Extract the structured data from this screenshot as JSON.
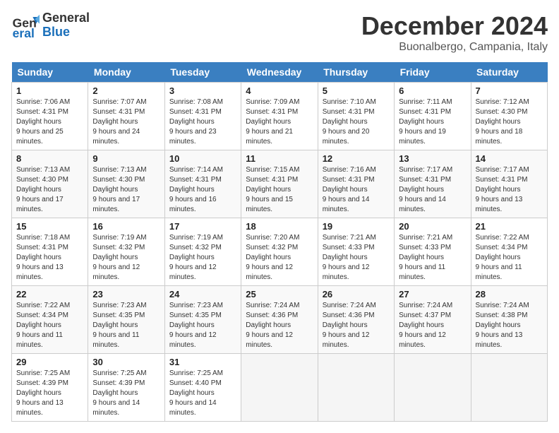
{
  "header": {
    "logo_line1": "General",
    "logo_line2": "Blue",
    "month_title": "December 2024",
    "location": "Buonalbergo, Campania, Italy"
  },
  "days": [
    "Sunday",
    "Monday",
    "Tuesday",
    "Wednesday",
    "Thursday",
    "Friday",
    "Saturday"
  ],
  "weeks": [
    [
      {
        "num": "1",
        "sunrise": "7:06 AM",
        "sunset": "4:31 PM",
        "daylight": "9 hours and 25 minutes."
      },
      {
        "num": "2",
        "sunrise": "7:07 AM",
        "sunset": "4:31 PM",
        "daylight": "9 hours and 24 minutes."
      },
      {
        "num": "3",
        "sunrise": "7:08 AM",
        "sunset": "4:31 PM",
        "daylight": "9 hours and 23 minutes."
      },
      {
        "num": "4",
        "sunrise": "7:09 AM",
        "sunset": "4:31 PM",
        "daylight": "9 hours and 21 minutes."
      },
      {
        "num": "5",
        "sunrise": "7:10 AM",
        "sunset": "4:31 PM",
        "daylight": "9 hours and 20 minutes."
      },
      {
        "num": "6",
        "sunrise": "7:11 AM",
        "sunset": "4:31 PM",
        "daylight": "9 hours and 19 minutes."
      },
      {
        "num": "7",
        "sunrise": "7:12 AM",
        "sunset": "4:30 PM",
        "daylight": "9 hours and 18 minutes."
      }
    ],
    [
      {
        "num": "8",
        "sunrise": "7:13 AM",
        "sunset": "4:30 PM",
        "daylight": "9 hours and 17 minutes."
      },
      {
        "num": "9",
        "sunrise": "7:13 AM",
        "sunset": "4:30 PM",
        "daylight": "9 hours and 17 minutes."
      },
      {
        "num": "10",
        "sunrise": "7:14 AM",
        "sunset": "4:31 PM",
        "daylight": "9 hours and 16 minutes."
      },
      {
        "num": "11",
        "sunrise": "7:15 AM",
        "sunset": "4:31 PM",
        "daylight": "9 hours and 15 minutes."
      },
      {
        "num": "12",
        "sunrise": "7:16 AM",
        "sunset": "4:31 PM",
        "daylight": "9 hours and 14 minutes."
      },
      {
        "num": "13",
        "sunrise": "7:17 AM",
        "sunset": "4:31 PM",
        "daylight": "9 hours and 14 minutes."
      },
      {
        "num": "14",
        "sunrise": "7:17 AM",
        "sunset": "4:31 PM",
        "daylight": "9 hours and 13 minutes."
      }
    ],
    [
      {
        "num": "15",
        "sunrise": "7:18 AM",
        "sunset": "4:31 PM",
        "daylight": "9 hours and 13 minutes."
      },
      {
        "num": "16",
        "sunrise": "7:19 AM",
        "sunset": "4:32 PM",
        "daylight": "9 hours and 12 minutes."
      },
      {
        "num": "17",
        "sunrise": "7:19 AM",
        "sunset": "4:32 PM",
        "daylight": "9 hours and 12 minutes."
      },
      {
        "num": "18",
        "sunrise": "7:20 AM",
        "sunset": "4:32 PM",
        "daylight": "9 hours and 12 minutes."
      },
      {
        "num": "19",
        "sunrise": "7:21 AM",
        "sunset": "4:33 PM",
        "daylight": "9 hours and 12 minutes."
      },
      {
        "num": "20",
        "sunrise": "7:21 AM",
        "sunset": "4:33 PM",
        "daylight": "9 hours and 11 minutes."
      },
      {
        "num": "21",
        "sunrise": "7:22 AM",
        "sunset": "4:34 PM",
        "daylight": "9 hours and 11 minutes."
      }
    ],
    [
      {
        "num": "22",
        "sunrise": "7:22 AM",
        "sunset": "4:34 PM",
        "daylight": "9 hours and 11 minutes."
      },
      {
        "num": "23",
        "sunrise": "7:23 AM",
        "sunset": "4:35 PM",
        "daylight": "9 hours and 11 minutes."
      },
      {
        "num": "24",
        "sunrise": "7:23 AM",
        "sunset": "4:35 PM",
        "daylight": "9 hours and 12 minutes."
      },
      {
        "num": "25",
        "sunrise": "7:24 AM",
        "sunset": "4:36 PM",
        "daylight": "9 hours and 12 minutes."
      },
      {
        "num": "26",
        "sunrise": "7:24 AM",
        "sunset": "4:36 PM",
        "daylight": "9 hours and 12 minutes."
      },
      {
        "num": "27",
        "sunrise": "7:24 AM",
        "sunset": "4:37 PM",
        "daylight": "9 hours and 12 minutes."
      },
      {
        "num": "28",
        "sunrise": "7:24 AM",
        "sunset": "4:38 PM",
        "daylight": "9 hours and 13 minutes."
      }
    ],
    [
      {
        "num": "29",
        "sunrise": "7:25 AM",
        "sunset": "4:39 PM",
        "daylight": "9 hours and 13 minutes."
      },
      {
        "num": "30",
        "sunrise": "7:25 AM",
        "sunset": "4:39 PM",
        "daylight": "9 hours and 14 minutes."
      },
      {
        "num": "31",
        "sunrise": "7:25 AM",
        "sunset": "4:40 PM",
        "daylight": "9 hours and 14 minutes."
      },
      null,
      null,
      null,
      null
    ]
  ],
  "labels": {
    "sunrise": "Sunrise:",
    "sunset": "Sunset:",
    "daylight": "Daylight hours"
  }
}
